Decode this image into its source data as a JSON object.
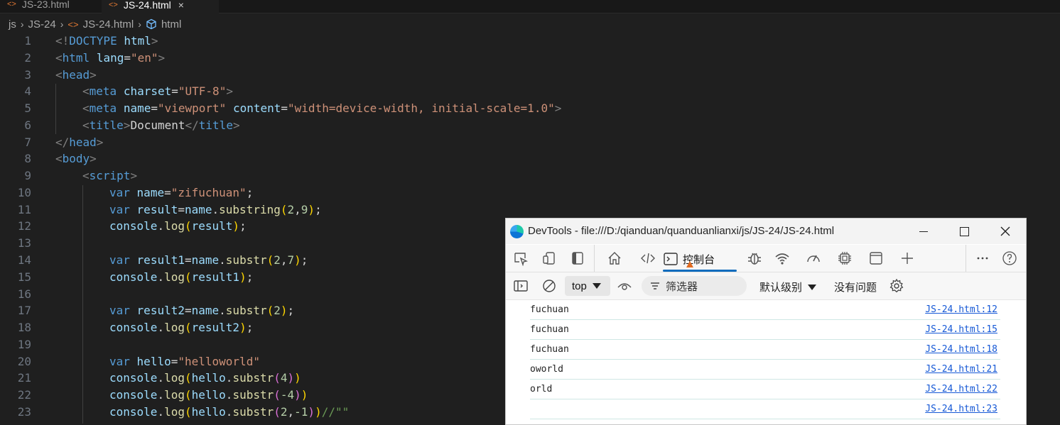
{
  "tabs": [
    {
      "label": "JS-23.html"
    },
    {
      "label": "JS-24.html",
      "close": "×"
    }
  ],
  "breadcrumb": {
    "parts": [
      "js",
      "JS-24",
      "JS-24.html",
      "html"
    ]
  },
  "editor": {
    "line_numbers": [
      "1",
      "2",
      "3",
      "4",
      "5",
      "6",
      "7",
      "8",
      "9",
      "10",
      "11",
      "12",
      "13",
      "14",
      "15",
      "16",
      "17",
      "18",
      "19",
      "20",
      "21",
      "22",
      "23"
    ]
  },
  "code": {
    "l1": [
      "<!",
      "DOCTYPE",
      " ",
      "html",
      ">"
    ],
    "l2": [
      "<",
      "html",
      " ",
      "lang",
      "=",
      "\"en\"",
      ">"
    ],
    "l3": [
      "<",
      "head",
      ">"
    ],
    "l4": [
      "<",
      "meta",
      " ",
      "charset",
      "=",
      "\"UTF-8\"",
      ">"
    ],
    "l5": [
      "<",
      "meta",
      " ",
      "name",
      "=",
      "\"viewport\"",
      " ",
      "content",
      "=",
      "\"width=device-width, initial-scale=1.0\"",
      ">"
    ],
    "l6": [
      "<",
      "title",
      ">",
      "Document",
      "</",
      "title",
      ">"
    ],
    "l7": [
      "</",
      "head",
      ">"
    ],
    "l8": [
      "<",
      "body",
      ">"
    ],
    "l9": [
      "<",
      "script",
      ">"
    ],
    "l10": [
      "var",
      " ",
      "name",
      "=",
      "\"zifuchuan\"",
      ";"
    ],
    "l11": [
      "var",
      " ",
      "result",
      "=",
      "name",
      ".",
      "substring",
      "(",
      "2",
      ",",
      "9",
      ")",
      ";"
    ],
    "l12": [
      "console",
      ".",
      "log",
      "(",
      "result",
      ")",
      ";"
    ],
    "l14": [
      "var",
      " ",
      "result1",
      "=",
      "name",
      ".",
      "substr",
      "(",
      "2",
      ",",
      "7",
      ")",
      ";"
    ],
    "l15": [
      "console",
      ".",
      "log",
      "(",
      "result1",
      ")",
      ";"
    ],
    "l17": [
      "var",
      " ",
      "result2",
      "=",
      "name",
      ".",
      "substr",
      "(",
      "2",
      ")",
      ";"
    ],
    "l18": [
      "console",
      ".",
      "log",
      "(",
      "result2",
      ")",
      ";"
    ],
    "l20": [
      "var",
      " ",
      "hello",
      "=",
      "\"helloworld\""
    ],
    "l21": [
      "console",
      ".",
      "log",
      "(",
      "hello",
      ".",
      "substr",
      "(",
      "4",
      ")",
      ")"
    ],
    "l22": [
      "console",
      ".",
      "log",
      "(",
      "hello",
      ".",
      "substr",
      "(",
      "-4",
      ")",
      ")"
    ],
    "l23": [
      "console",
      ".",
      "log",
      "(",
      "hello",
      ".",
      "substr",
      "(",
      "2",
      ",",
      "-1",
      ")",
      ")",
      "//\"\""
    ]
  },
  "devtools": {
    "title": "DevTools - file:///D:/qianduan/quanduanlianxi/js/JS-24/JS-24.html",
    "console_tab": "控制台",
    "context": "top",
    "filter_placeholder": "筛选器",
    "levels": "默认级别",
    "issues": "没有问题",
    "messages": [
      {
        "text": "fuchuan",
        "source": "JS-24.html:12"
      },
      {
        "text": "fuchuan",
        "source": "JS-24.html:15"
      },
      {
        "text": "fuchuan",
        "source": "JS-24.html:18"
      },
      {
        "text": "oworld",
        "source": "JS-24.html:21"
      },
      {
        "text": "orld",
        "source": "JS-24.html:22"
      },
      {
        "text": "",
        "source": "JS-24.html:23"
      }
    ]
  },
  "colors": {
    "editor_bg": "#1f1f1f",
    "tag": "#569cd6",
    "string": "#ce9178",
    "function": "#dcdcaa",
    "variable": "#9cdcfe",
    "number": "#b5cea8",
    "link": "#1558d6",
    "accent": "#0f6cbd"
  },
  "icons": [
    "html-file-icon",
    "chevron-right-icon",
    "cube-icon",
    "edge-logo-icon",
    "minimize-icon",
    "maximize-icon",
    "close-icon",
    "inspect-icon",
    "device-icon",
    "sidebar-icon",
    "welcome-home-icon",
    "elements-icon",
    "console-icon",
    "warning-icon",
    "sources-bug-icon",
    "network-icon",
    "performance-icon",
    "memory-icon",
    "application-icon",
    "add-icon",
    "more-icon",
    "help-icon",
    "clear-console-icon",
    "eye-icon",
    "filter-icon",
    "dropdown-icon",
    "settings-gear-icon"
  ]
}
